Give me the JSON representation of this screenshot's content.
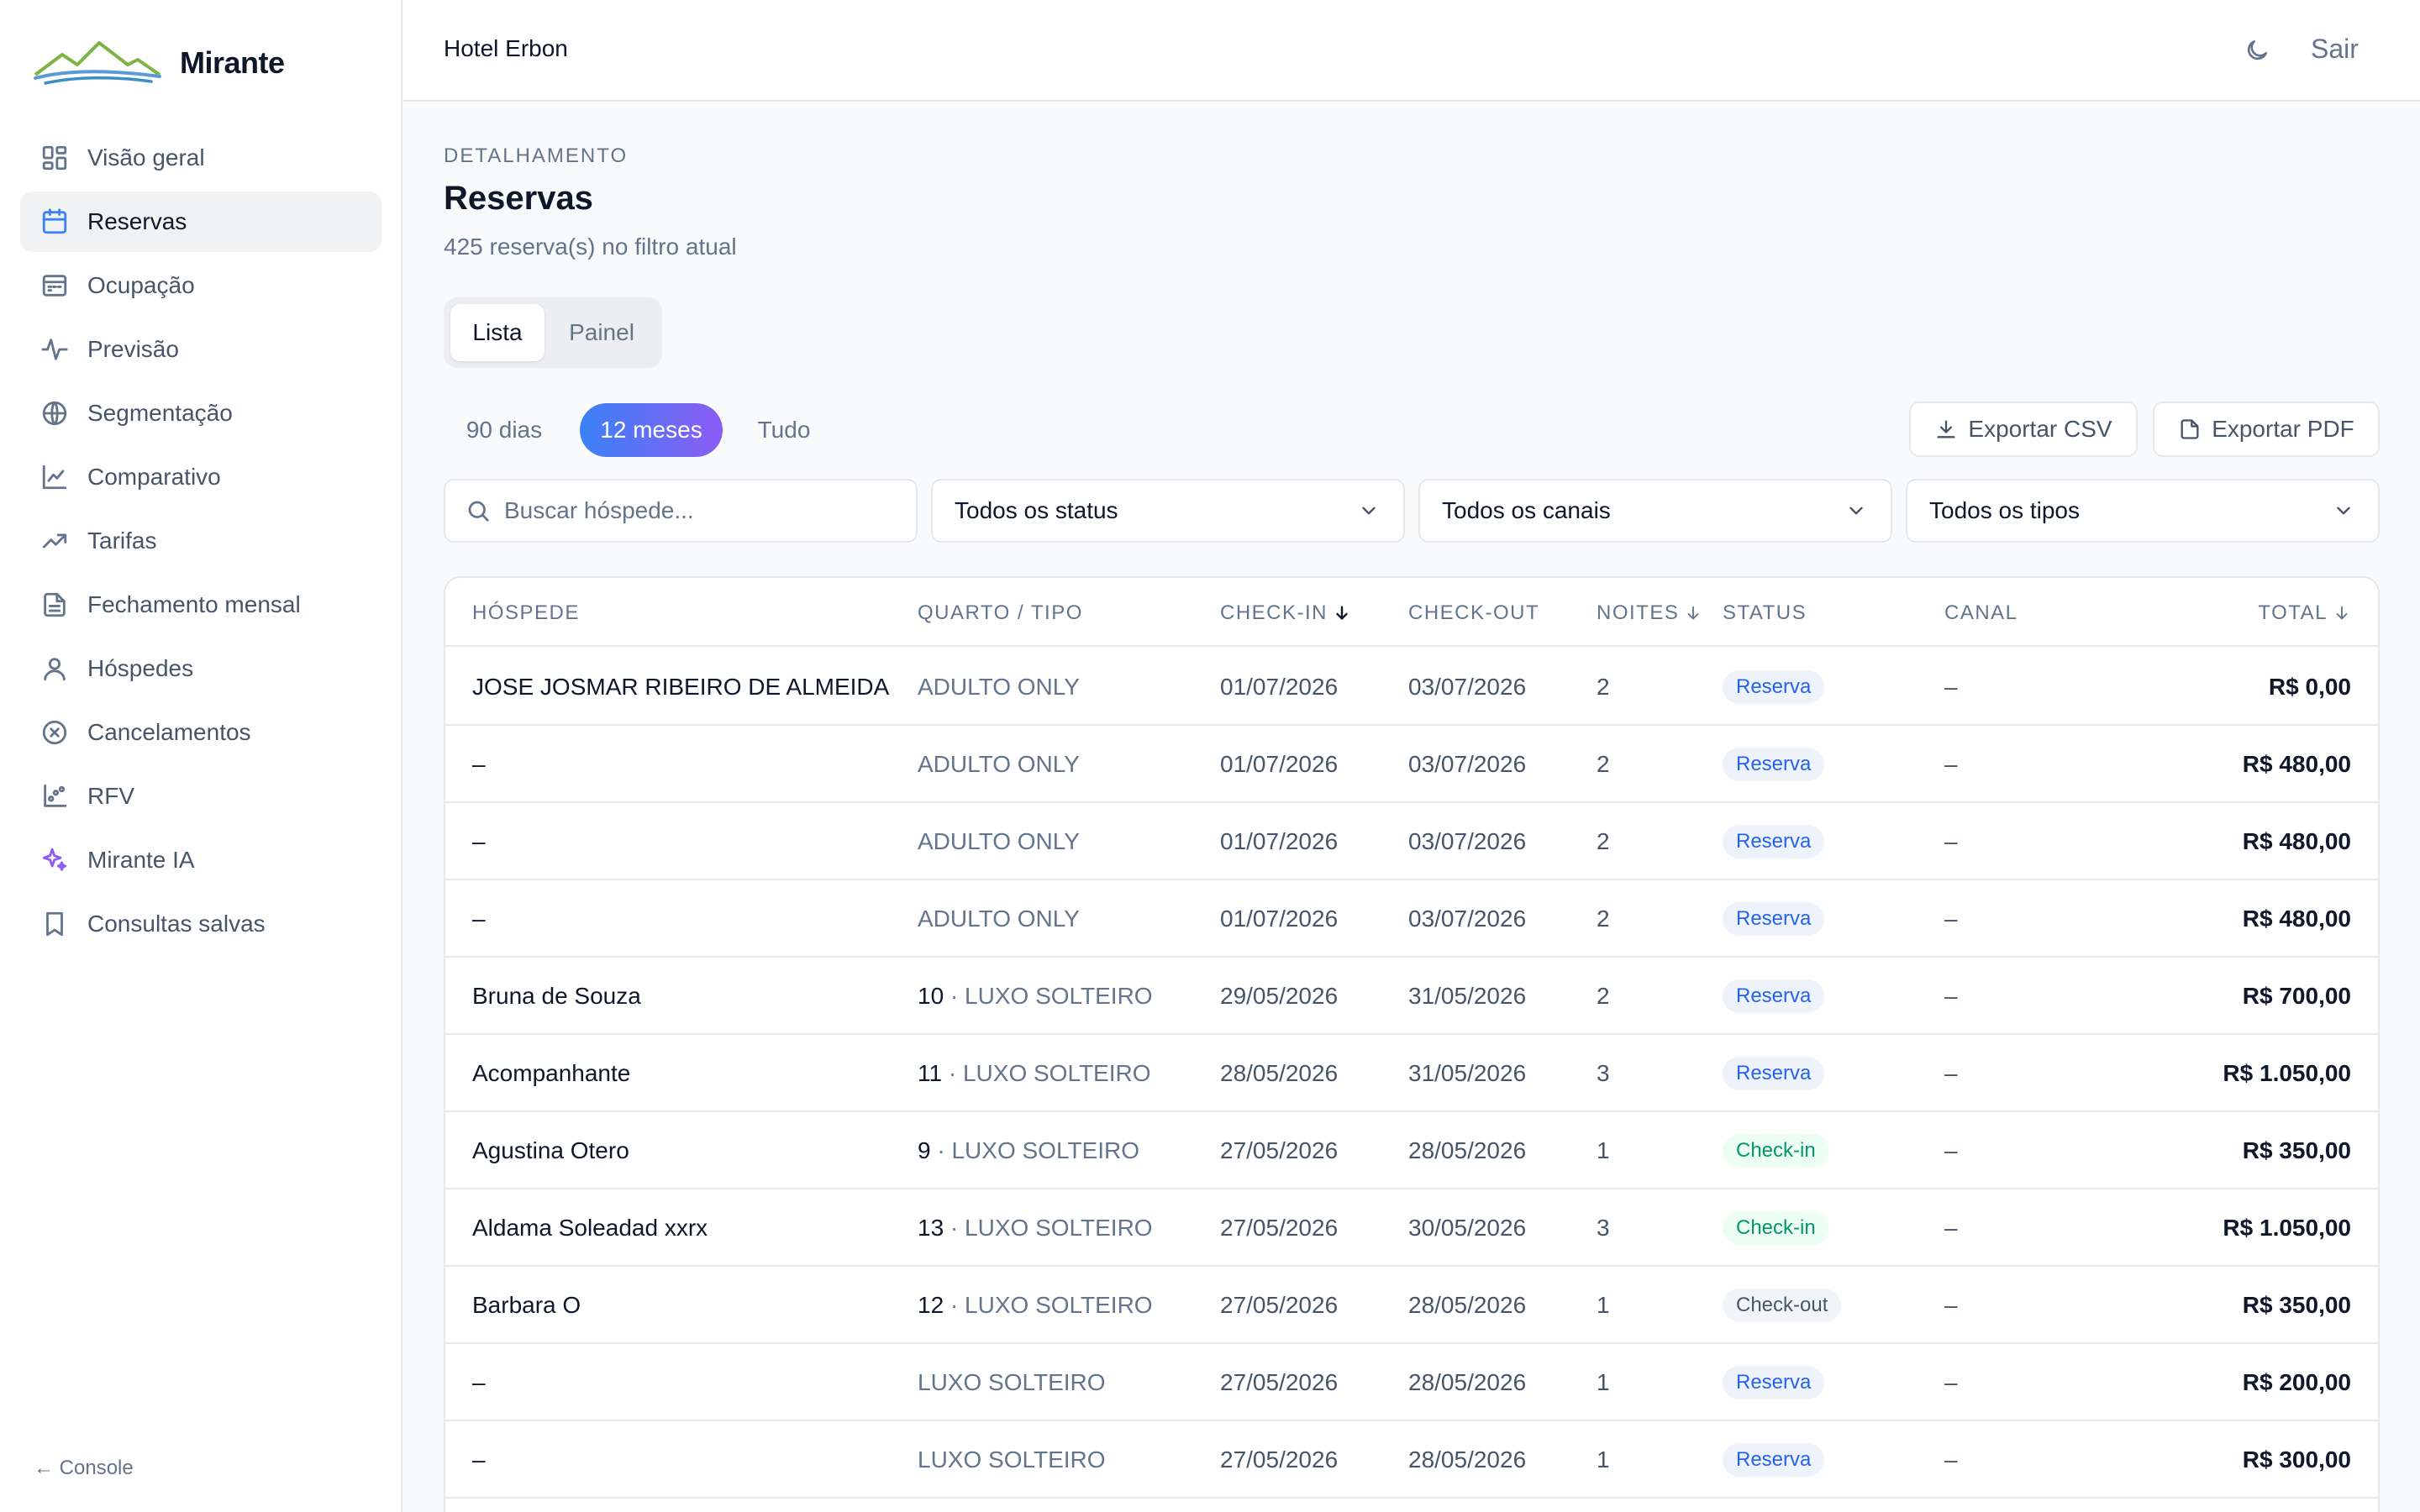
{
  "brand": {
    "name": "Mirante"
  },
  "sidebar": {
    "items": [
      {
        "label": "Visão geral",
        "icon": "dashboard-icon"
      },
      {
        "label": "Reservas",
        "icon": "calendar-icon",
        "active": true
      },
      {
        "label": "Ocupação",
        "icon": "occupancy-icon"
      },
      {
        "label": "Previsão",
        "icon": "activity-icon"
      },
      {
        "label": "Segmentação",
        "icon": "globe-icon"
      },
      {
        "label": "Comparativo",
        "icon": "line-chart-icon"
      },
      {
        "label": "Tarifas",
        "icon": "trending-up-icon"
      },
      {
        "label": "Fechamento mensal",
        "icon": "document-icon"
      },
      {
        "label": "Hóspedes",
        "icon": "user-icon"
      },
      {
        "label": "Cancelamentos",
        "icon": "x-circle-icon"
      },
      {
        "label": "RFV",
        "icon": "scatter-icon"
      },
      {
        "label": "Mirante IA",
        "icon": "sparkles-icon"
      },
      {
        "label": "Consultas salvas",
        "icon": "bookmark-icon"
      }
    ],
    "console_label": "← Console"
  },
  "header": {
    "hotel": "Hotel Erbon",
    "logout_label": "Sair"
  },
  "main": {
    "eyebrow": "DETALHAMENTO",
    "title": "Reservas",
    "subtitle": "425 reserva(s) no filtro atual",
    "view_tabs": [
      "Lista",
      "Painel"
    ],
    "ranges": [
      "90 dias",
      "12 meses",
      "Tudo"
    ],
    "export_csv": "Exportar CSV",
    "export_pdf": "Exportar PDF",
    "search_placeholder": "Buscar hóspede...",
    "filters": {
      "status": "Todos os status",
      "canal": "Todos os canais",
      "tipo": "Todos os tipos"
    }
  },
  "table": {
    "headers": {
      "guest": "HÓSPEDE",
      "room": "QUARTO / TIPO",
      "checkin": "CHECK-IN",
      "checkout": "CHECK-OUT",
      "nights": "NOITES",
      "status": "STATUS",
      "canal": "CANAL",
      "total": "TOTAL"
    },
    "rows": [
      {
        "guest": "JOSE JOSMAR RIBEIRO DE ALMEIDA",
        "room_num": "",
        "room_type": "ADULTO ONLY",
        "checkin": "01/07/2026",
        "checkout": "03/07/2026",
        "nights": "2",
        "status": "Reserva",
        "canal": "–",
        "total": "R$ 0,00"
      },
      {
        "guest": "–",
        "room_num": "",
        "room_type": "ADULTO ONLY",
        "checkin": "01/07/2026",
        "checkout": "03/07/2026",
        "nights": "2",
        "status": "Reserva",
        "canal": "–",
        "total": "R$ 480,00"
      },
      {
        "guest": "–",
        "room_num": "",
        "room_type": "ADULTO ONLY",
        "checkin": "01/07/2026",
        "checkout": "03/07/2026",
        "nights": "2",
        "status": "Reserva",
        "canal": "–",
        "total": "R$ 480,00"
      },
      {
        "guest": "–",
        "room_num": "",
        "room_type": "ADULTO ONLY",
        "checkin": "01/07/2026",
        "checkout": "03/07/2026",
        "nights": "2",
        "status": "Reserva",
        "canal": "–",
        "total": "R$ 480,00"
      },
      {
        "guest": "Bruna de Souza",
        "room_num": "10",
        "room_type": "LUXO SOLTEIRO",
        "checkin": "29/05/2026",
        "checkout": "31/05/2026",
        "nights": "2",
        "status": "Reserva",
        "canal": "–",
        "total": "R$ 700,00"
      },
      {
        "guest": "Acompanhante",
        "room_num": "11",
        "room_type": "LUXO SOLTEIRO",
        "checkin": "28/05/2026",
        "checkout": "31/05/2026",
        "nights": "3",
        "status": "Reserva",
        "canal": "–",
        "total": "R$ 1.050,00"
      },
      {
        "guest": "Agustina Otero",
        "room_num": "9",
        "room_type": "LUXO SOLTEIRO",
        "checkin": "27/05/2026",
        "checkout": "28/05/2026",
        "nights": "1",
        "status": "Check-in",
        "canal": "–",
        "total": "R$ 350,00"
      },
      {
        "guest": "Aldama Soleadad xxrx",
        "room_num": "13",
        "room_type": "LUXO SOLTEIRO",
        "checkin": "27/05/2026",
        "checkout": "30/05/2026",
        "nights": "3",
        "status": "Check-in",
        "canal": "–",
        "total": "R$ 1.050,00"
      },
      {
        "guest": "Barbara O",
        "room_num": "12",
        "room_type": "LUXO SOLTEIRO",
        "checkin": "27/05/2026",
        "checkout": "28/05/2026",
        "nights": "1",
        "status": "Check-out",
        "canal": "–",
        "total": "R$ 350,00"
      },
      {
        "guest": "–",
        "room_num": "",
        "room_type": "LUXO SOLTEIRO",
        "checkin": "27/05/2026",
        "checkout": "28/05/2026",
        "nights": "1",
        "status": "Reserva",
        "canal": "–",
        "total": "R$ 200,00"
      },
      {
        "guest": "–",
        "room_num": "",
        "room_type": "LUXO SOLTEIRO",
        "checkin": "27/05/2026",
        "checkout": "28/05/2026",
        "nights": "1",
        "status": "Reserva",
        "canal": "–",
        "total": "R$ 300,00"
      }
    ]
  },
  "colors": {
    "accent_blue": "#3b82f6",
    "accent_purple": "#8b5cf6",
    "status_reserva": "#2563eb",
    "status_checkin": "#059669",
    "status_checkout": "#475569"
  }
}
